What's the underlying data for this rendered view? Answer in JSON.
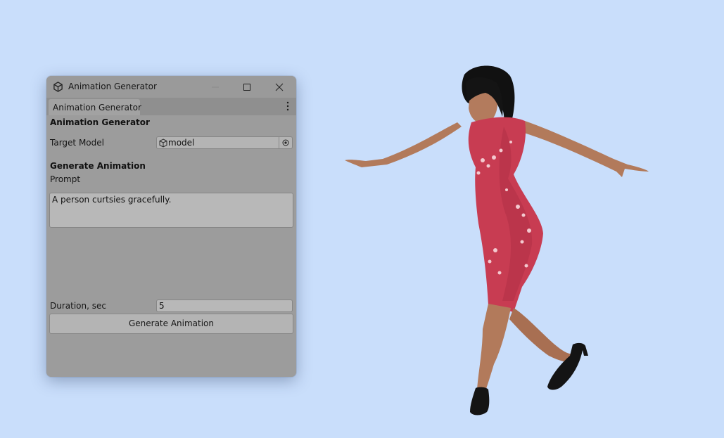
{
  "window": {
    "title": "Animation Generator",
    "icon": "unity-logo-icon",
    "controls": [
      "minimize-icon",
      "maximize-icon",
      "close-icon"
    ]
  },
  "tab": {
    "label": "Animation Generator",
    "menu_icon": "kebab-menu-icon"
  },
  "panel": {
    "header": "Animation Generator",
    "target_model": {
      "label": "Target Model",
      "value": "model",
      "icon": "cube-icon",
      "picker_icon": "object-picker-icon"
    },
    "generate_section": {
      "header": "Generate Animation",
      "prompt_label": "Prompt",
      "prompt_value": "A person curtsies gracefully.",
      "duration_label": "Duration, sec",
      "duration_value": "5",
      "button_label": "Generate Animation"
    }
  },
  "scene": {
    "background": "#c9defb",
    "figure": "female character in red floral qipao and black heels"
  }
}
